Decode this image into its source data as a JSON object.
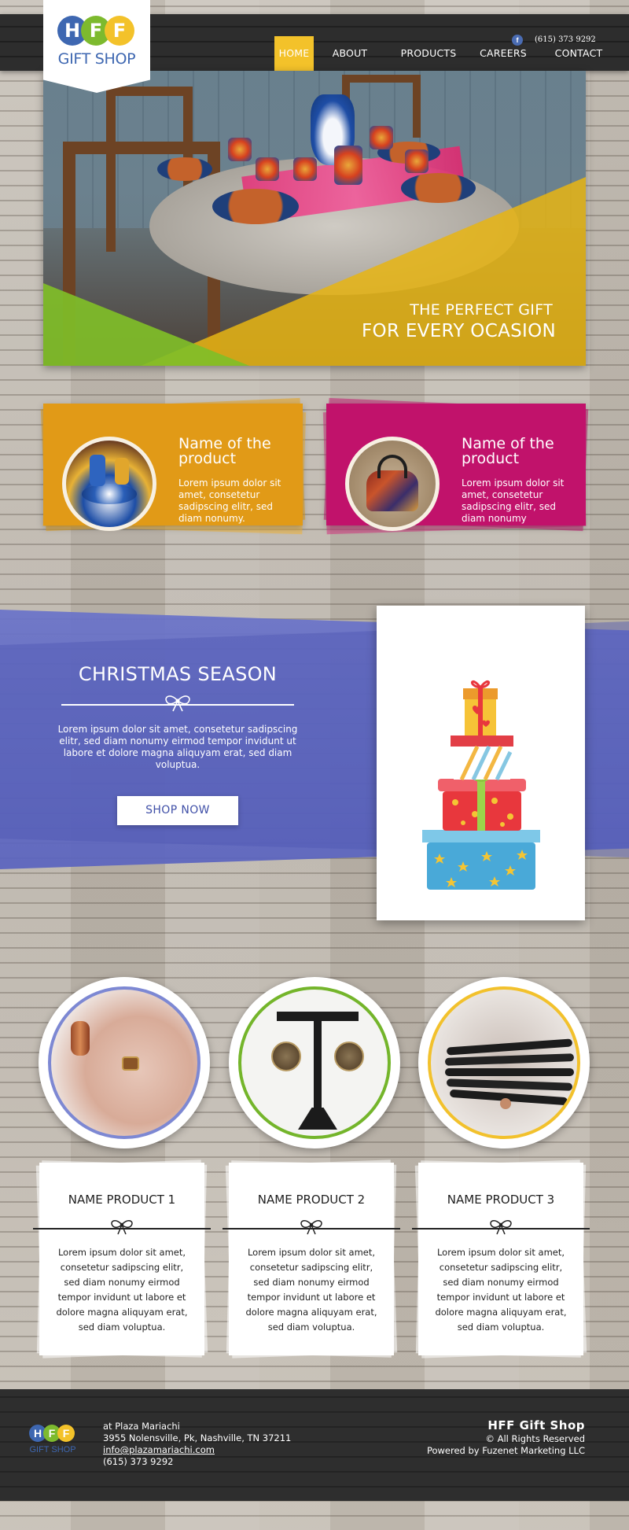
{
  "colors": {
    "accent_yellow": "#f3c22a",
    "orange_card": "#e19a17",
    "magenta_card": "#c1126b",
    "band_blue": "#5b64bf",
    "logo_blue": "#3e67b1",
    "logo_green": "#7dba2e"
  },
  "header": {
    "logo_letters": [
      "H",
      "F",
      "F"
    ],
    "logo_subtitle": "GIFT SHOP",
    "facebook_icon": "facebook-icon",
    "facebook_glyph": "f",
    "phone": "(615) 373 9292",
    "nav": [
      {
        "label": "HOME",
        "active": true
      },
      {
        "label": "ABOUT",
        "active": false
      },
      {
        "label": "PRODUCTS",
        "active": false
      },
      {
        "label": "CAREERS",
        "active": false
      },
      {
        "label": "CONTACT",
        "active": false
      }
    ]
  },
  "hero": {
    "line1": "THE PERFECT GIFT",
    "line2": "FOR EVERY OCASION"
  },
  "features": [
    {
      "title": "Name of the product",
      "text": "Lorem ipsum dolor sit amet, consetetur sadipscing elitr, sed diam nonumy."
    },
    {
      "title": "Name of the product",
      "text": "Lorem ipsum dolor sit amet, consetetur sadipscing elitr, sed diam nonumy"
    }
  ],
  "christmas": {
    "title": "CHRISTMAS SEASON",
    "text": "Lorem ipsum dolor sit amet, consetetur sadipscing elitr, sed diam nonumy eirmod tempor invidunt ut labore et dolore magna aliquyam erat, sed diam voluptua.",
    "button": "SHOP NOW",
    "image_icon": "gift-stack-icon"
  },
  "products": [
    {
      "title": "NAME PRODUCT 1",
      "text": "Lorem ipsum dolor sit amet, consetetur sadipscing elitr, sed diam nonumy eirmod tempor invidunt ut labore et dolore magna aliquyam erat, sed diam voluptua.",
      "ring": "#7d88d3"
    },
    {
      "title": "NAME PRODUCT 2",
      "text": "Lorem ipsum dolor sit amet, consetetur sadipscing elitr, sed diam nonumy eirmod tempor invidunt ut labore et dolore magna aliquyam erat, sed diam voluptua.",
      "ring": "#74b52b"
    },
    {
      "title": "NAME PRODUCT 3",
      "text": "Lorem ipsum dolor sit amet, consetetur sadipscing elitr, sed diam nonumy eirmod tempor invidunt ut labore et dolore magna aliquyam erat, sed diam voluptua.",
      "ring": "#f2c12c"
    }
  ],
  "footer": {
    "location": "at Plaza Mariachi",
    "address": "3955 Nolensville, Pk, Nashville, TN 37211",
    "email": "info@plazamariachi.com",
    "phone": "(615) 373 9292",
    "brand": "HFF Gift Shop",
    "rights": "© All Rights Reserved",
    "powered": "Powered by Fuzenet Marketing LLC"
  }
}
